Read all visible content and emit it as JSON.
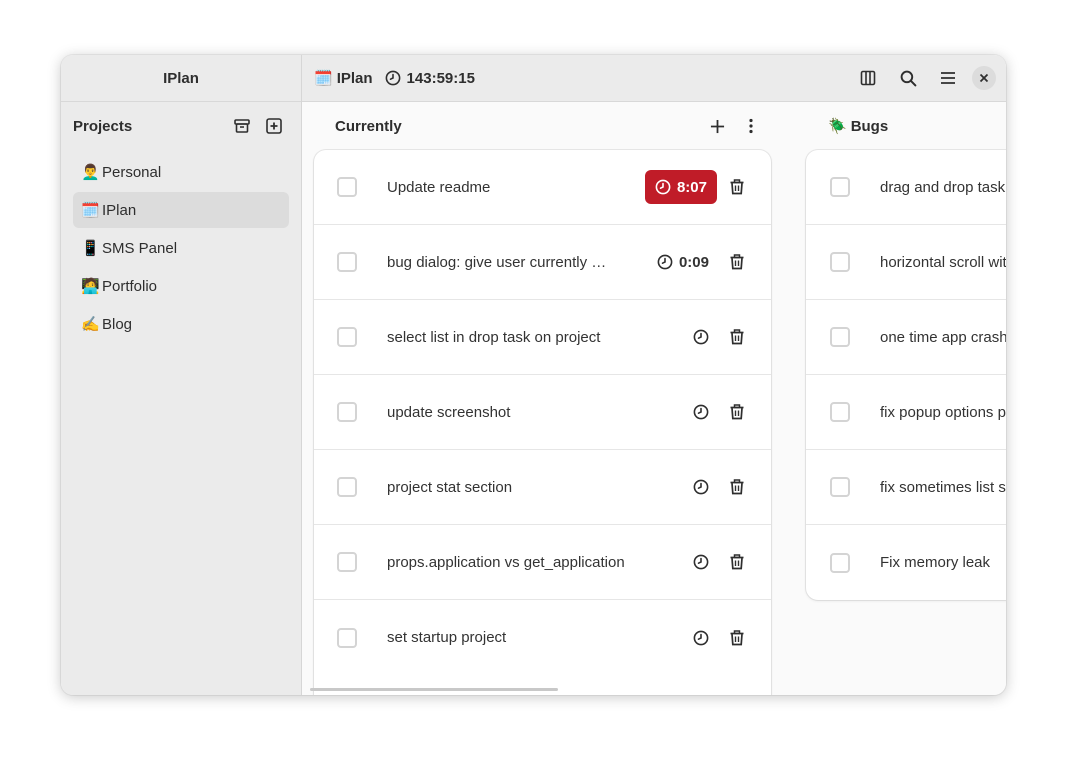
{
  "app": {
    "title": "IPlan"
  },
  "sidebar": {
    "projects_label": "Projects",
    "archive_icon": "archive-icon",
    "add_icon": "add-project-icon",
    "items": [
      {
        "emoji": "👨‍🦱",
        "label": "Personal",
        "active": false
      },
      {
        "emoji": "🗓️",
        "label": "IPlan",
        "active": true
      },
      {
        "emoji": "📱",
        "label": "SMS Panel",
        "active": false
      },
      {
        "emoji": "🧑‍💻",
        "label": "Portfolio",
        "active": false
      },
      {
        "emoji": "✍️",
        "label": "Blog",
        "active": false
      }
    ]
  },
  "header": {
    "project_emoji": "🗓️",
    "project_name": "IPlan",
    "total_time": "143:59:15",
    "actions": [
      "columns-icon",
      "search-icon",
      "menu-icon",
      "close-icon"
    ]
  },
  "lists": [
    {
      "name": "Currently",
      "emoji": "",
      "tasks": [
        {
          "text": "Update readme",
          "timer": "8:07",
          "running": true
        },
        {
          "text": "bug dialog: give user currently …",
          "timer": "0:09",
          "running": false
        },
        {
          "text": "select list in drop task on project",
          "timer": "",
          "running": false
        },
        {
          "text": "update screenshot",
          "timer": "",
          "running": false
        },
        {
          "text": "project stat section",
          "timer": "",
          "running": false
        },
        {
          "text": "props.application vs get_application",
          "timer": "",
          "running": false
        },
        {
          "text": "set startup project",
          "timer": "",
          "running": false
        }
      ]
    },
    {
      "name": "Bugs",
      "emoji": "🪲",
      "tasks": [
        {
          "text": "drag and drop task s"
        },
        {
          "text": "horizontal scroll wit"
        },
        {
          "text": "one time app crashe"
        },
        {
          "text": "fix popup options po"
        },
        {
          "text": "fix sometimes list se"
        },
        {
          "text": "Fix memory leak"
        }
      ]
    }
  ],
  "colors": {
    "accent_running": "#c01c28",
    "sidebar_bg": "#ebebeb",
    "active_item": "#dcdcdc"
  }
}
